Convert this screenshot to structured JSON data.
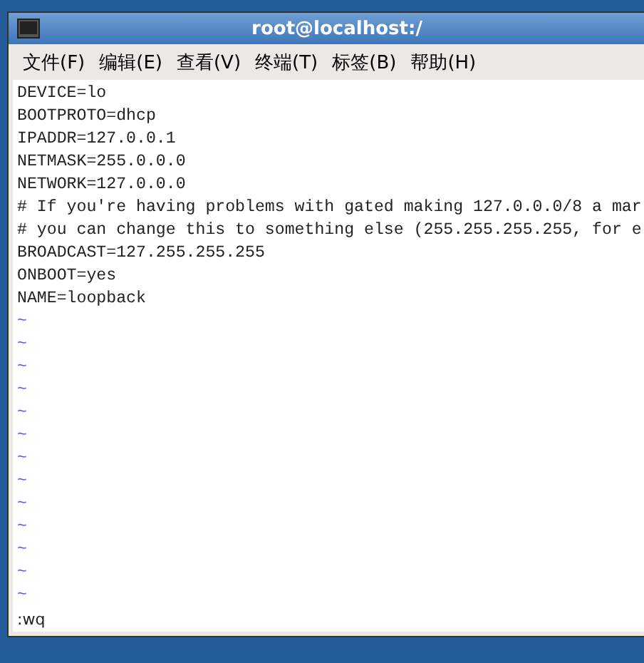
{
  "window": {
    "title": "root@localhost:/"
  },
  "menu": [
    "文件(F)",
    "编辑(E)",
    "查看(V)",
    "终端(T)",
    "标签(B)",
    "帮助(H)"
  ],
  "editor": {
    "lines": [
      "DEVICE=lo",
      "BOOTPROTO=dhcp",
      "IPADDR=127.0.0.1",
      "NETMASK=255.0.0.0",
      "NETWORK=127.0.0.0",
      "# If you're having problems with gated making 127.0.0.0/8 a mar",
      "# you can change this to something else (255.255.255.255, for e",
      "BROADCAST=127.255.255.255",
      "ONBOOT=yes",
      "NAME=loopback"
    ],
    "empty_lines": [
      "~",
      "~",
      "~",
      "~",
      "~",
      "~",
      "~",
      "~",
      "~",
      "~",
      "~",
      "~",
      "~"
    ],
    "command": ":wq"
  }
}
